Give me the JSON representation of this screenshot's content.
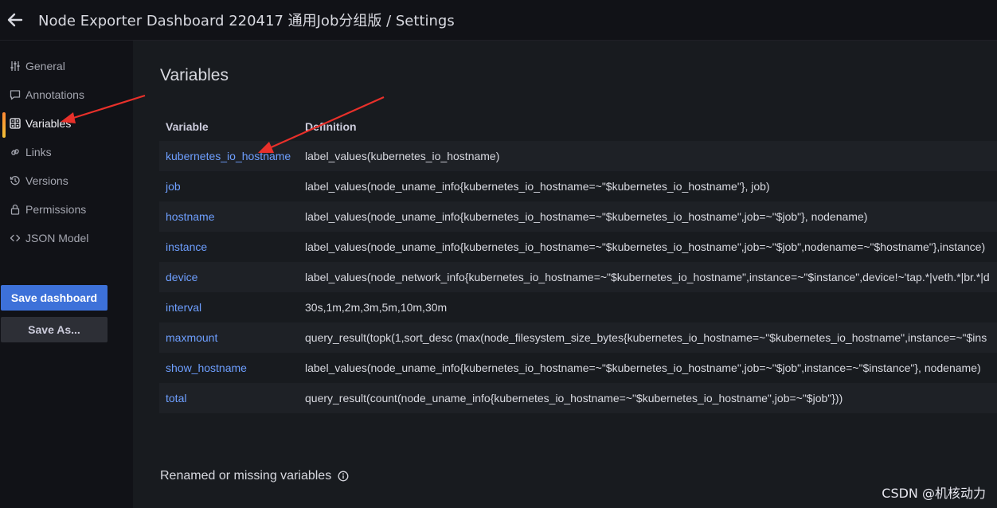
{
  "header": {
    "title": "Node Exporter Dashboard 220417 通用Job分组版 / Settings"
  },
  "sidebar": {
    "items": [
      {
        "label": "General",
        "icon": "sliders-icon"
      },
      {
        "label": "Annotations",
        "icon": "comment-icon"
      },
      {
        "label": "Variables",
        "icon": "calculator-icon",
        "active": true
      },
      {
        "label": "Links",
        "icon": "link-icon"
      },
      {
        "label": "Versions",
        "icon": "history-icon"
      },
      {
        "label": "Permissions",
        "icon": "lock-icon"
      },
      {
        "label": "JSON Model",
        "icon": "code-icon"
      }
    ],
    "save_label": "Save dashboard",
    "save_as_label": "Save As..."
  },
  "main": {
    "heading": "Variables",
    "columns": [
      "Variable",
      "Definition"
    ],
    "rows": [
      {
        "name": "kubernetes_io_hostname",
        "definition": "label_values(kubernetes_io_hostname)"
      },
      {
        "name": "job",
        "definition": "label_values(node_uname_info{kubernetes_io_hostname=~\"$kubernetes_io_hostname\"}, job)"
      },
      {
        "name": "hostname",
        "definition": "label_values(node_uname_info{kubernetes_io_hostname=~\"$kubernetes_io_hostname\",job=~\"$job\"}, nodename)"
      },
      {
        "name": "instance",
        "definition": "label_values(node_uname_info{kubernetes_io_hostname=~\"$kubernetes_io_hostname\",job=~\"$job\",nodename=~\"$hostname\"},instance)"
      },
      {
        "name": "device",
        "definition": "label_values(node_network_info{kubernetes_io_hostname=~\"$kubernetes_io_hostname\",instance=~\"$instance\",device!~'tap.*|veth.*|br.*|d"
      },
      {
        "name": "interval",
        "definition": "30s,1m,2m,3m,5m,10m,30m"
      },
      {
        "name": "maxmount",
        "definition": "query_result(topk(1,sort_desc (max(node_filesystem_size_bytes{kubernetes_io_hostname=~\"$kubernetes_io_hostname\",instance=~\"$ins"
      },
      {
        "name": "show_hostname",
        "definition": "label_values(node_uname_info{kubernetes_io_hostname=~\"$kubernetes_io_hostname\",job=~\"$job\",instance=~\"$instance\"}, nodename)"
      },
      {
        "name": "total",
        "definition": "query_result(count(node_uname_info{kubernetes_io_hostname=~\"$kubernetes_io_hostname\",job=~\"$job\"}))"
      }
    ],
    "renamed_label": "Renamed or missing variables"
  },
  "watermark": "CSDN @机核动力",
  "colors": {
    "accent_blue": "#3d71d9",
    "link": "#6e9fff",
    "annotation_arrow": "#e8302a"
  }
}
